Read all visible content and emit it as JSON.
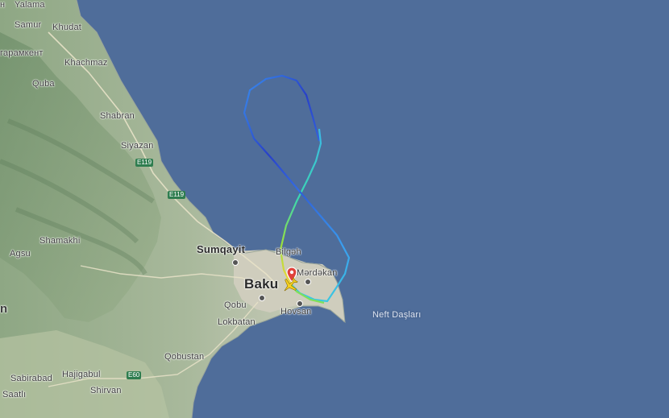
{
  "map": {
    "land_color": "#c9c9b8",
    "sea_color": "#4f6d9a",
    "labels": {
      "yalama": "Yalama",
      "n_cut": "н",
      "samur": "Samur",
      "khudat": "Khudat",
      "garamkent": "гарамкент",
      "khachmaz": "Khachmaz",
      "quba": "Quba",
      "shabran": "Shabran",
      "siyazan": "Siyazan",
      "sumqayit": "Sumqayit",
      "bilgah": "Bilgəh",
      "mardakan": "Mərdəkan",
      "baku": "Baku",
      "shamakhi": "Shamakhi",
      "agsu": "Agsu",
      "qobu": "Qobu",
      "hovsan": "Hovsan",
      "lokbatan": "Lokbatan",
      "qobustan": "Qobustan",
      "neft_daslari": "Neft Daşları",
      "sabirabad": "Sabirabad",
      "hajigabul": "Hajigabul",
      "shirvan": "Shirvan",
      "saatli": "Saatlı",
      "left_n": "n"
    },
    "road_badges": {
      "e119a": "E119",
      "e119b": "E119",
      "e60": "E60"
    }
  },
  "flight_path": {
    "gradient_colors": [
      "#f2d43a",
      "#9be03c",
      "#3fe08a",
      "#3bc8e0",
      "#3a8ff0",
      "#2f4fd8",
      "#3a80f0",
      "#3bc8e0"
    ],
    "origin_marker_color": "#e0413a",
    "aircraft_color": "#f5d020"
  }
}
